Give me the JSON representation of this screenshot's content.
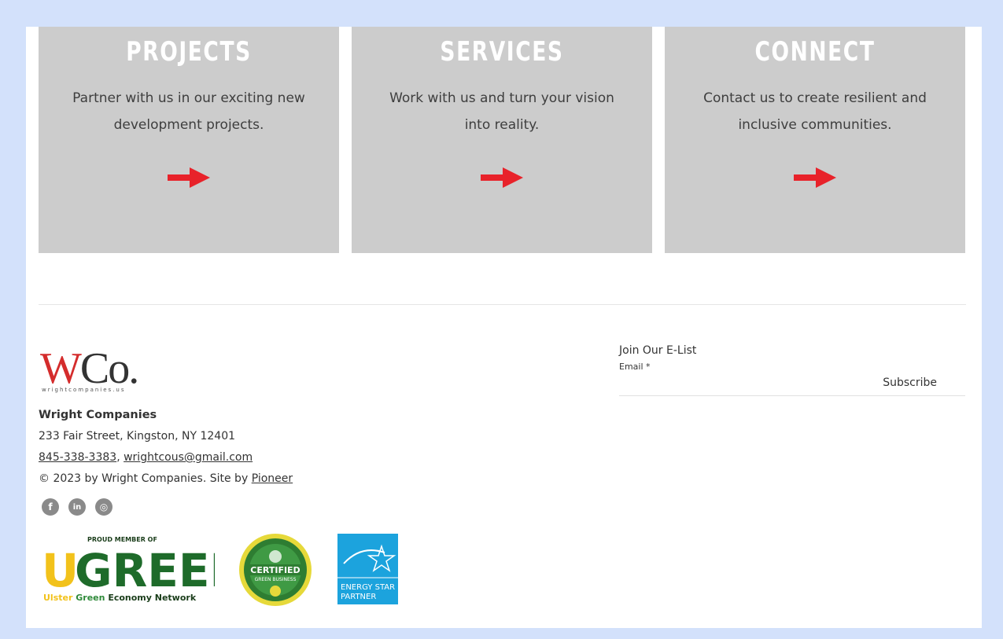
{
  "cards": [
    {
      "title": "PROJECTS",
      "description": "Partner with us in our exciting new development projects."
    },
    {
      "title": "SERVICES",
      "description": "Work with us and turn your vision into reality."
    },
    {
      "title": "CONNECT",
      "description": "Contact us to create resilient and inclusive communities."
    }
  ],
  "logo": {
    "w": "W",
    "co": "Co.",
    "sub": "wrightcompanies.us"
  },
  "address": {
    "company": "Wright Companies",
    "street": "233 Fair Street, Kingston,  NY 12401",
    "phone": "845-338-3383",
    "separator": ",",
    "email": "wrightcous@gmail.com",
    "copyright": "© 2023 by Wright Companies. Site by ",
    "site_by_link": "Pioneer"
  },
  "social": {
    "facebook": "f",
    "linkedin": "in",
    "instagram": "◎"
  },
  "badges": {
    "ugreen_top": "PROUD MEMBER OF",
    "ugreen_logo": "UGREEN",
    "ugreen_ulster": "Ulster",
    "ugreen_green": "Green",
    "ugreen_rest": "Economy Network",
    "cert_main": "CERTIFIED",
    "cert_sub": "GREEN BUSINESS",
    "estar_line1": "ENERGY STAR",
    "estar_line2": "PARTNER"
  },
  "elist": {
    "title": "Join Our E-List",
    "email_label": "Email *",
    "subscribe_label": "Subscribe"
  },
  "colors": {
    "card_bg": "#cccccc",
    "arrow": "#e8222a",
    "page_bg": "#d3e1fb",
    "logo_red": "#d42c2c"
  }
}
